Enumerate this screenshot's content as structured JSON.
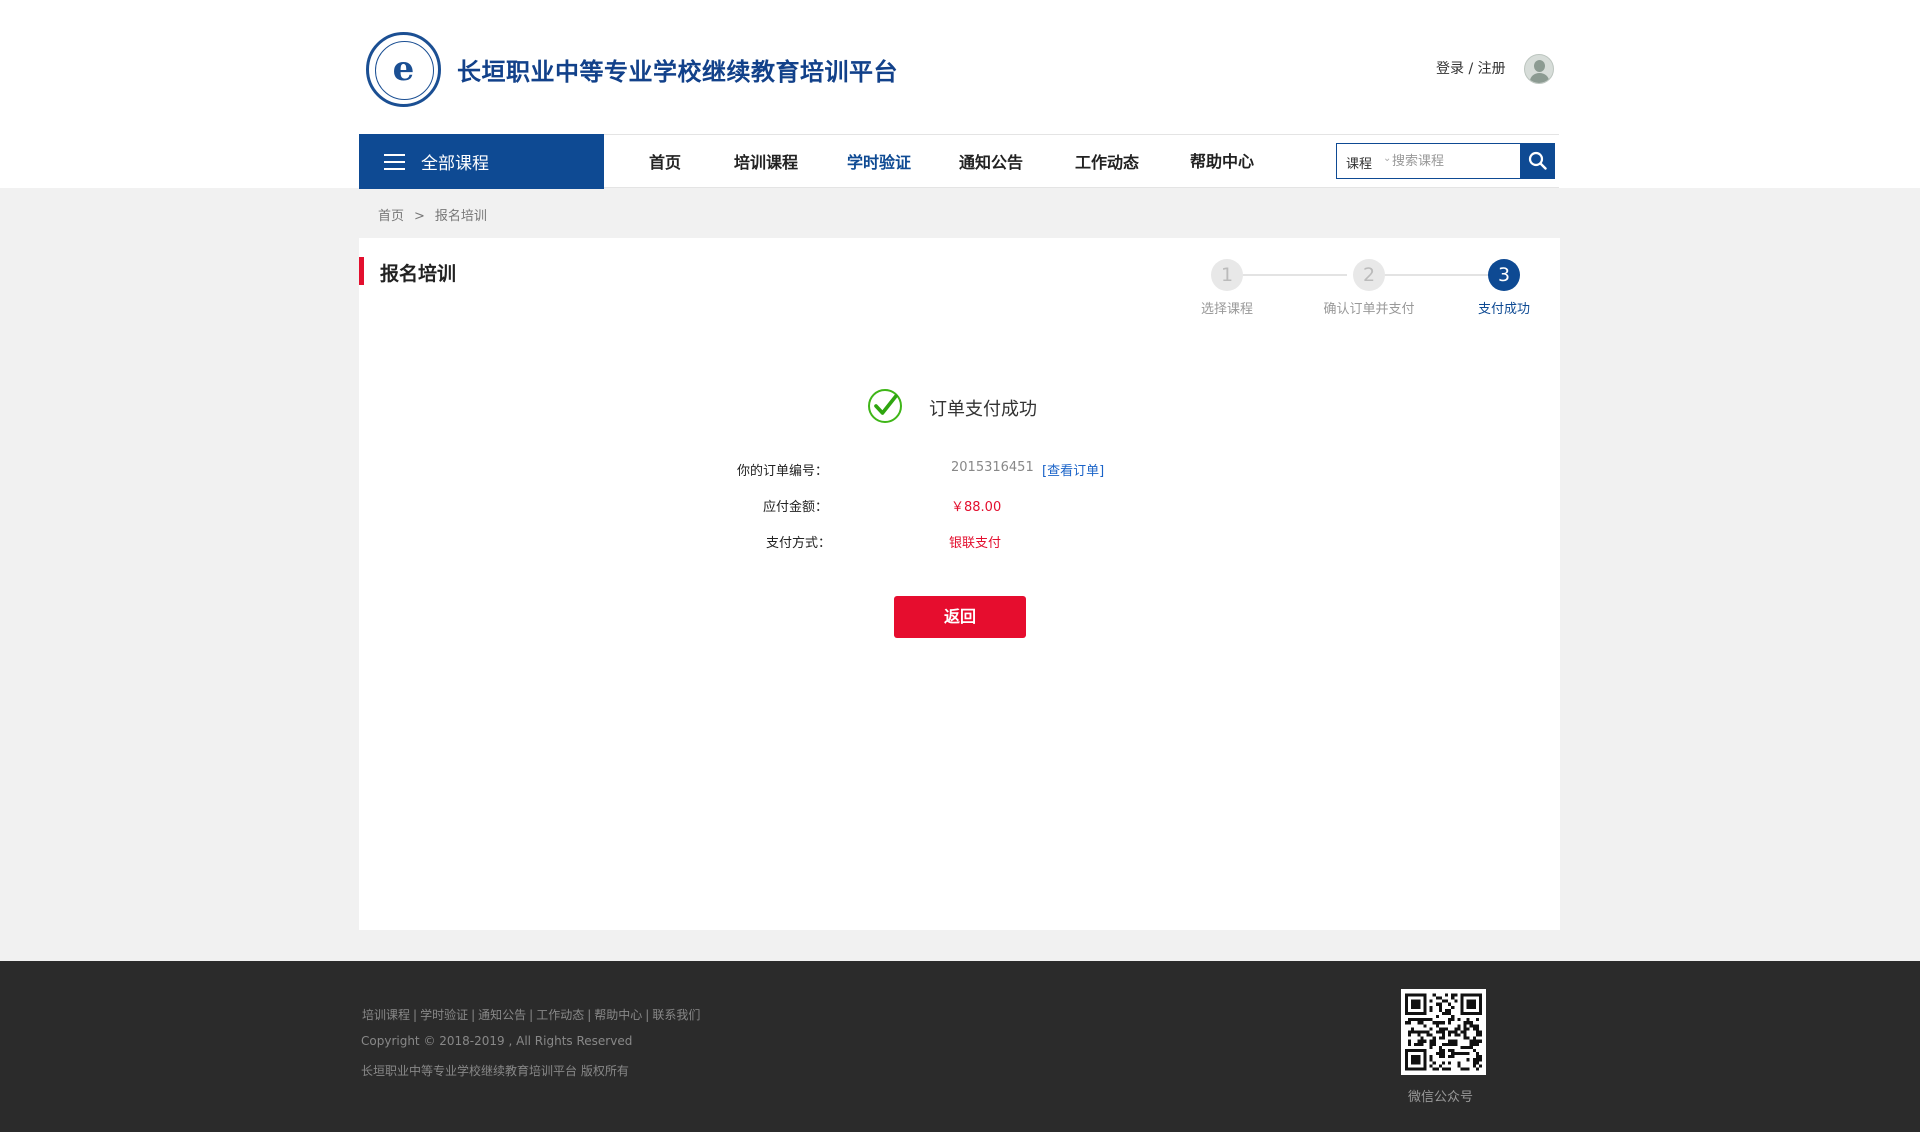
{
  "header": {
    "site_title": "长垣职业中等专业学校继续教育培训平台",
    "emblem_letter": "e",
    "login_register": "登录 / 注册"
  },
  "nav": {
    "all_courses": "全部课程",
    "items": [
      {
        "label": "首页",
        "active": false
      },
      {
        "label": "培训课程",
        "active": false
      },
      {
        "label": "学时验证",
        "active": true
      },
      {
        "label": "通知公告",
        "active": false
      },
      {
        "label": "工作动态",
        "active": false
      },
      {
        "label": "帮助中心",
        "active": false
      }
    ],
    "search": {
      "type": "课程",
      "placeholder": "搜索课程"
    }
  },
  "breadcrumb": {
    "home": "首页",
    "separator": ">",
    "current": "报名培训"
  },
  "panel": {
    "title": "报名培训",
    "steps": [
      {
        "number": "1",
        "label": "选择课程",
        "done": false
      },
      {
        "number": "2",
        "label": "确认订单并支付",
        "done": false
      },
      {
        "number": "3",
        "label": "支付成功",
        "done": true
      }
    ],
    "success_message": "订单支付成功",
    "order_number_label": "你的订单编号：",
    "order_number": "2015316451",
    "view_order": "[查看订单]",
    "amount_label": "应付金额：",
    "amount": "￥88.00",
    "payment_method_label": "支付方式：",
    "payment_method": "银联支付",
    "back_button": "返回"
  },
  "footer": {
    "links": [
      "培训课程",
      "学时验证",
      "通知公告",
      "工作动态",
      "帮助中心",
      "联系我们"
    ],
    "link_separator": "|",
    "copyright": "Copyright © 2018-2019 , All Rights Reserved",
    "owner": "长垣职业中等专业学校继续教育培训平台  版权所有",
    "qr_label": "微信公众号"
  },
  "colors": {
    "brand_blue": "#0e4a93",
    "accent_red": "#e30f2e",
    "success_green": "#3fb618"
  }
}
